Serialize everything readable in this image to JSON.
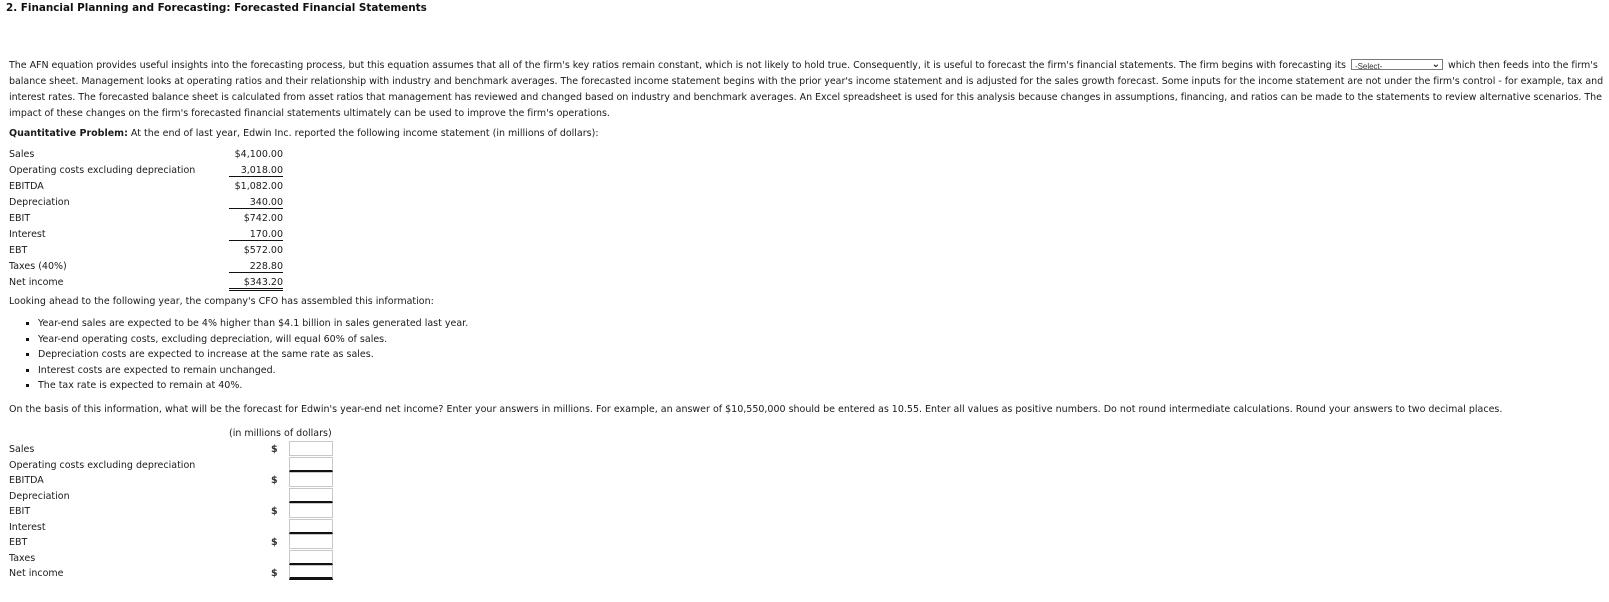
{
  "title": "2.  Financial Planning and Forecasting: Forecasted Financial Statements",
  "intro": {
    "before_select": "The AFN equation provides useful insights into the forecasting process, but this equation assumes that all of the firm's key ratios remain constant, which is not likely to hold true. Consequently, it is useful to forecast the firm's financial statements. The firm begins with forecasting its",
    "select_value": "-Select-",
    "after_select": "which then feeds into the firm's balance sheet. Management looks at operating ratios and their relationship with industry and benchmark averages. The forecasted income statement begins with the prior year's income statement and is adjusted for the sales growth forecast. Some inputs for the income statement are not under the firm's control - for example, tax and interest rates. The forecasted balance sheet is calculated from asset ratios that management has reviewed and changed based on industry and benchmark averages. An Excel spreadsheet is used for this analysis because changes in assumptions, financing, and ratios can be made to the statements to review alternative scenarios. The impact of these changes on the firm's forecasted financial statements ultimately can be used to improve the firm's operations."
  },
  "quantitative_problem": {
    "label": "Quantitative Problem:",
    "text": " At the end of last year, Edwin Inc. reported the following income statement (in millions of dollars):"
  },
  "income_statement": [
    {
      "label": "Sales",
      "value": "$4,100.00"
    },
    {
      "label": "Operating costs excluding depreciation",
      "value": "3,018.00"
    },
    {
      "label": "EBITDA",
      "value": "$1,082.00"
    },
    {
      "label": "Depreciation",
      "value": "340.00"
    },
    {
      "label": "EBIT",
      "value": "$742.00"
    },
    {
      "label": "Interest",
      "value": "170.00"
    },
    {
      "label": "EBT",
      "value": "$572.00"
    },
    {
      "label": "Taxes (40%)",
      "value": "228.80"
    },
    {
      "label": "Net income",
      "value": "$343.20"
    }
  ],
  "lookahead": "Looking ahead to the following year, the company's CFO has assembled this information:",
  "bullets": [
    "Year-end sales are expected to be 4% higher than $4.1 billion in sales generated last year.",
    "Year-end operating costs, excluding depreciation, will equal 60% of sales.",
    "Depreciation costs are expected to increase at the same rate as sales.",
    "Interest costs are expected to remain unchanged.",
    "The tax rate is expected to remain at 40%."
  ],
  "question": "On the basis of this information, what will be the forecast for Edwin's year-end net income? Enter your answers in millions. For example, an answer of $10,550,000 should be entered as 10.55. Enter all values as positive numbers. Do not round intermediate calculations. Round your answers to two decimal places.",
  "answer_table": {
    "units": "(in millions of dollars)",
    "rows": [
      {
        "label": "Sales",
        "dollar": "$",
        "value": ""
      },
      {
        "label": "Operating costs excluding depreciation",
        "dollar": "",
        "value": ""
      },
      {
        "label": "EBITDA",
        "dollar": "$",
        "value": ""
      },
      {
        "label": "Depreciation",
        "dollar": "",
        "value": ""
      },
      {
        "label": "EBIT",
        "dollar": "$",
        "value": ""
      },
      {
        "label": "Interest",
        "dollar": "",
        "value": ""
      },
      {
        "label": "EBT",
        "dollar": "$",
        "value": ""
      },
      {
        "label": "Taxes",
        "dollar": "",
        "value": ""
      },
      {
        "label": "Net income",
        "dollar": "$",
        "value": ""
      }
    ]
  }
}
